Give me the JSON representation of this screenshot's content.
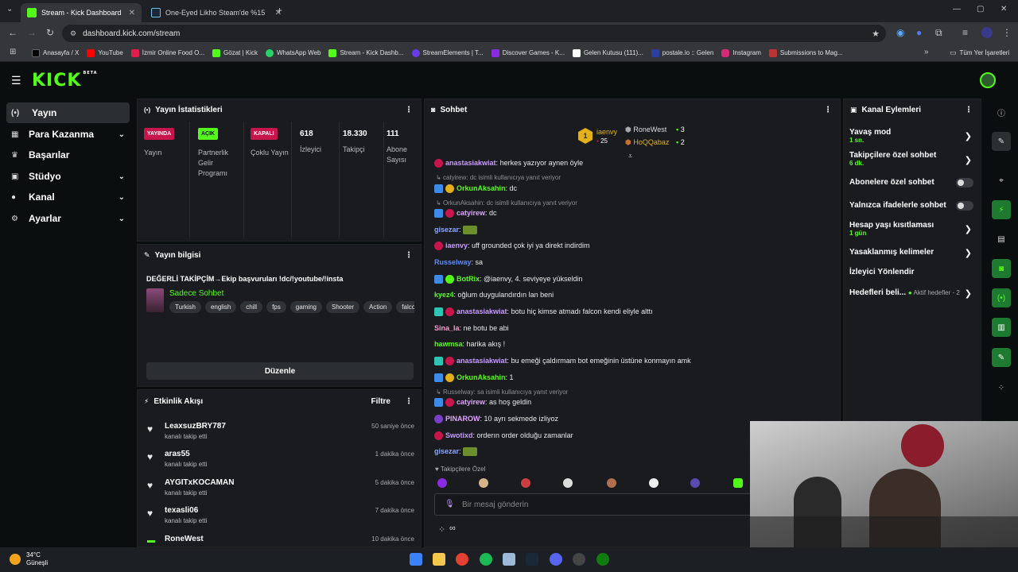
{
  "browser": {
    "tabs": [
      {
        "title": "Stream - Kick Dashboard",
        "active": true
      },
      {
        "title": "One-Eyed Likho Steam'de %15",
        "active": false
      }
    ],
    "url": "dashboard.kick.com/stream",
    "bookmarks": [
      "Anasayfa / X",
      "YouTube",
      "İzmir Online Food O...",
      "Gözat | Kick",
      "WhatsApp Web",
      "Stream - Kick Dashb...",
      "StreamElements | T...",
      "Discover Games - K...",
      "Gelen Kutusu (111)...",
      "postale.io :: Gelen",
      "Instagram",
      "Submissions to Mag..."
    ],
    "all_bookmarks": "Tüm Yer İşaretleri"
  },
  "brand": {
    "logo": "KICK",
    "beta": "BETA",
    "accent": "#53fc18"
  },
  "sidebar": {
    "items": [
      {
        "label": "Yayın",
        "icon": "broadcast-icon",
        "active": true
      },
      {
        "label": "Para Kazanma",
        "icon": "money-icon",
        "chevron": true
      },
      {
        "label": "Başarılar",
        "icon": "trophy-icon"
      },
      {
        "label": "Stüdyo",
        "icon": "studio-icon",
        "chevron": true
      },
      {
        "label": "Kanal",
        "icon": "user-icon",
        "chevron": true
      },
      {
        "label": "Ayarlar",
        "icon": "gear-icon",
        "chevron": true
      }
    ]
  },
  "stats": {
    "title": "Yayın İstatistikleri",
    "cols": [
      {
        "badge": "YAYINDA",
        "label": "Yayın"
      },
      {
        "badge": "AÇIK",
        "label": "Partnerlik Gelir Programı"
      },
      {
        "badge": "KAPALI",
        "label": "Çoklu Yayın"
      },
      {
        "value": "618",
        "label": "İzleyici"
      },
      {
        "value": "18.330",
        "label": "Takipçi"
      },
      {
        "value": "111",
        "label": "Abone Sayısı"
      }
    ]
  },
  "streaminfo": {
    "title": "Yayın bilgisi",
    "stream_title": "DEĞERLİ TAKİPÇİM→Ekip başvuruları !dc/!youtube/!insta",
    "category": "Sadece Sohbet",
    "tags": [
      "Turkish",
      "english",
      "chill",
      "fps",
      "gaming",
      "Shooter",
      "Action",
      "falcon"
    ],
    "edit": "Düzenle"
  },
  "events": {
    "title": "Etkinlik Akışı",
    "filter": "Filtre",
    "items": [
      {
        "name": "LeaxsuzBRY787",
        "sub": "kanalı takip etti",
        "time": "50 saniye önce"
      },
      {
        "name": "aras55",
        "sub": "kanalı takip etti",
        "time": "1 dakika önce"
      },
      {
        "name": "AYGITxKOCAMAN",
        "sub": "kanalı takip etti",
        "time": "5 dakika önce"
      },
      {
        "name": "texasli06",
        "sub": "kanalı takip etti",
        "time": "7 dakika önce"
      },
      {
        "name": "RoneWest",
        "sub": "",
        "time": "10 dakika önce"
      }
    ]
  },
  "chat": {
    "title": "Sohbet",
    "leaders": [
      {
        "rank": "1",
        "name": "iaenvy",
        "count": "25"
      },
      {
        "name": "RoneWest",
        "count": "3"
      },
      {
        "name": "HoQQabaz",
        "count": "2"
      }
    ],
    "lines": [
      {
        "user": "anastasiakwiat",
        "color": "#c99cff",
        "text": "herkes yazıyor aynen öyle"
      },
      {
        "reply": "catyirew: dc isimli kullanıcıya yanıt veriyor"
      },
      {
        "user": "OrkunAksahin",
        "color": "#53fc18",
        "text": "dc"
      },
      {
        "reply": "OrkunAksahin: dc isimli kullanıcıya yanıt veriyor"
      },
      {
        "user": "catyirew",
        "color": "#e0a4ff",
        "text": "dc"
      },
      {
        "user": "gisezar",
        "color": "#8aa8ff",
        "text": ""
      },
      {
        "user": "iaenvy",
        "color": "#c99cff",
        "text": "uff grounded çok iyi ya direkt indirdim"
      },
      {
        "user": "Russelway",
        "color": "#5a8dff",
        "text": "sa"
      },
      {
        "user": "BotRix",
        "color": "#53fc18",
        "text": "@iaenvy, 4. seviyeye yükseldin"
      },
      {
        "user": "kyez4",
        "color": "#53fc18",
        "text": "oğlum duygulandırdın lan beni"
      },
      {
        "user": "anastasiakwiat",
        "color": "#c99cff",
        "text": "botu hiç kimse atmadı falcon kendi eliyle alttı"
      },
      {
        "user": "Sina_la",
        "color": "#ff9bd0",
        "text": "ne botu be abi"
      },
      {
        "user": "hawmsa",
        "color": "#53fc18",
        "text": "harika akış !"
      },
      {
        "user": "anastasiakwiat",
        "color": "#c99cff",
        "text": "bu emeği çaldırmam bot emeğinin üstüne konmayın amk"
      },
      {
        "user": "OrkunAksahin",
        "color": "#53fc18",
        "text": "1"
      },
      {
        "reply": "Russelway: sa isimli kullanıcıya yanıt veriyor"
      },
      {
        "user": "catyirew",
        "color": "#e0a4ff",
        "text": "as hoş geldin"
      },
      {
        "user": "PINAROW",
        "color": "#e0a4ff",
        "text": "10 ayrı sekmede izliyoz"
      },
      {
        "user": "Swotixd",
        "color": "#c99cff",
        "text": "orderın order olduğu zamanlar"
      },
      {
        "user": "gisezar",
        "color": "#8aa8ff",
        "text": ""
      }
    ],
    "followers_only": "Takipçilere Özel",
    "placeholder": "Bir mesaj gönderin"
  },
  "channel": {
    "title": "Kanal Eylemleri",
    "items": [
      {
        "label": "Yavaş mod",
        "sub": "1 sn.",
        "type": "chevron"
      },
      {
        "label": "Takipçilere özel sohbet",
        "sub": "6 dk.",
        "type": "chevron"
      },
      {
        "label": "Abonelere özel sohbet",
        "sub": "",
        "type": "toggle"
      },
      {
        "label": "Yalnızca ifadelerle sohbet",
        "sub": "",
        "type": "toggle"
      },
      {
        "label": "Hesap yaşı kısıtlaması",
        "sub": "1 gün",
        "type": "chevron"
      },
      {
        "label": "Yasaklanmış kelimeler",
        "sub": "",
        "type": "chevron"
      },
      {
        "label": "İzleyici Yönlendir",
        "sub": "",
        "type": "none"
      },
      {
        "label": "Hedefleri beli...",
        "sub": "",
        "type": "chevron",
        "extra": "Aktif hedefler - 2"
      }
    ]
  },
  "weather": {
    "temp": "34°C",
    "desc": "Güneşli"
  }
}
